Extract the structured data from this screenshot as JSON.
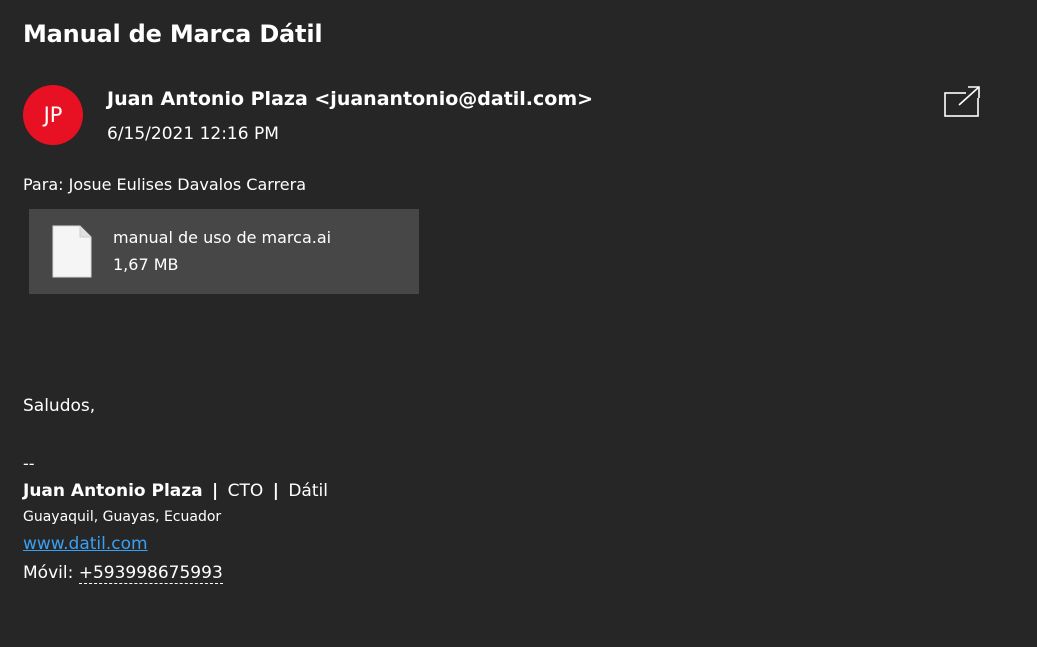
{
  "email": {
    "subject": "Manual de Marca Dátil",
    "avatar_initials": "JP",
    "avatar_color": "#e81123",
    "sender": "Juan Antonio Plaza <juanantonio@datil.com>",
    "date": "6/15/2021 12:16 PM",
    "to_line": "Para: Josue Eulises Davalos Carrera",
    "popout_icon": "open-in-new-window-icon"
  },
  "attachment": {
    "name": "manual de uso de marca.ai",
    "size": "1,67 MB",
    "icon": "file-icon"
  },
  "body": {
    "greeting": "Saludos,"
  },
  "signature": {
    "dash": "--",
    "name": "Juan Antonio Plaza",
    "separator": "|",
    "role": "CTO",
    "company": "Dátil",
    "location": "Guayaquil, Guayas, Ecuador",
    "website": "www.datil.com",
    "phone_label": "Móvil:",
    "phone": "+593998675993",
    "link_color": "#3aa0f3"
  }
}
